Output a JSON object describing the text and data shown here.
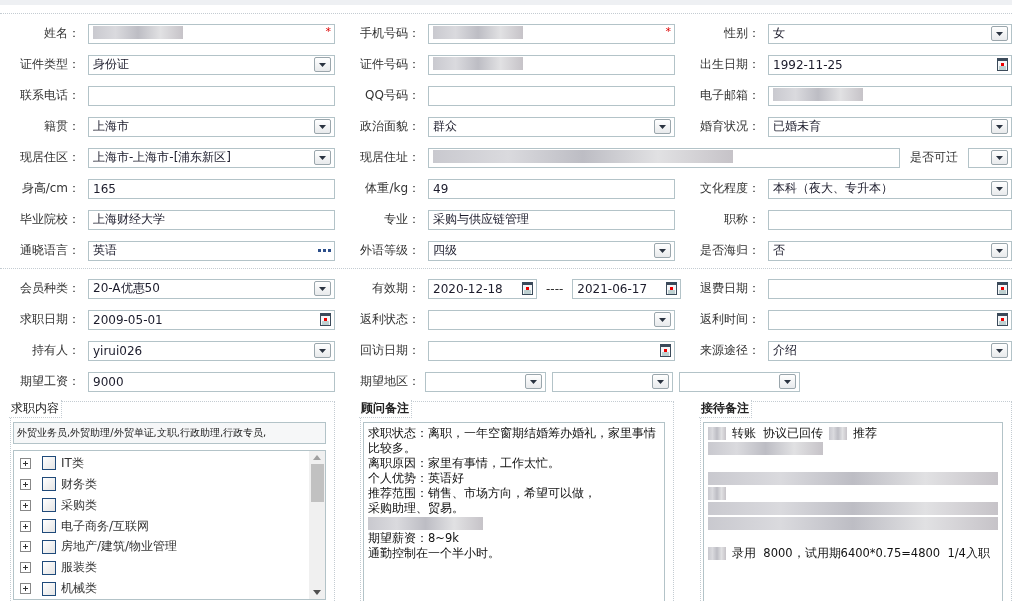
{
  "personal": [
    {
      "cells": [
        {
          "label": "姓名：",
          "kind": "text",
          "redacted": true,
          "required_mark": "*"
        },
        {
          "label": "手机号码：",
          "kind": "text",
          "redacted": true,
          "required_mark": "*"
        },
        {
          "label": "性别：",
          "kind": "select",
          "value": "女"
        }
      ]
    },
    {
      "cells": [
        {
          "label": "证件类型：",
          "kind": "select",
          "value": "身份证"
        },
        {
          "label": "证件号码：",
          "kind": "text",
          "redacted": true
        },
        {
          "label": "出生日期：",
          "kind": "date",
          "value": "1992-11-25"
        }
      ]
    },
    {
      "cells": [
        {
          "label": "联系电话：",
          "kind": "text"
        },
        {
          "label": "QQ号码：",
          "kind": "text"
        },
        {
          "label": "电子邮箱：",
          "kind": "text",
          "redacted": true
        }
      ]
    },
    {
      "cells": [
        {
          "label": "籍贯：",
          "kind": "select",
          "value": "上海市"
        },
        {
          "label": "政治面貌：",
          "kind": "select",
          "value": "群众"
        },
        {
          "label": "婚育状况：",
          "kind": "select",
          "value": "已婚未育"
        }
      ]
    },
    {
      "cells": [
        {
          "label": "现居住区：",
          "kind": "select",
          "value": "上海市-上海市-[浦东新区]"
        },
        {
          "label": "现居住址：",
          "kind": "wide_text",
          "redacted": true
        },
        {
          "label": "是否可迁",
          "kind": "short_select"
        }
      ]
    },
    {
      "cells": [
        {
          "label": "身高/cm：",
          "kind": "text",
          "value": "165"
        },
        {
          "label": "体重/kg：",
          "kind": "text",
          "value": "49"
        },
        {
          "label": "文化程度：",
          "kind": "select",
          "value": "本科（夜大、专升本）"
        }
      ]
    },
    {
      "cells": [
        {
          "label": "毕业院校：",
          "kind": "text",
          "value": "上海财经大学"
        },
        {
          "label": "专业：",
          "kind": "text",
          "value": "采购与供应链管理"
        },
        {
          "label": "职称：",
          "kind": "text"
        }
      ]
    },
    {
      "cells": [
        {
          "label": "通晓语言：",
          "kind": "picker",
          "value": "英语"
        },
        {
          "label": "外语等级：",
          "kind": "select",
          "value": "四级"
        },
        {
          "label": "是否海归：",
          "kind": "select",
          "value": "否"
        }
      ]
    }
  ],
  "membership": [
    {
      "cells": [
        {
          "label": "会员种类：",
          "kind": "select",
          "value": "20-A优惠50"
        },
        {
          "label": "有效期：",
          "kind": "daterange",
          "from": "2020-12-18",
          "separator": "----",
          "to": "2021-06-17"
        },
        {
          "label": "退费日期：",
          "kind": "date"
        }
      ]
    },
    {
      "cells": [
        {
          "label": "求职日期：",
          "kind": "date",
          "value": "2009-05-01"
        },
        {
          "label": "返利状态：",
          "kind": "select"
        },
        {
          "label": "返利时间：",
          "kind": "date"
        }
      ]
    },
    {
      "cells": [
        {
          "label": "持有人：",
          "kind": "select",
          "value": "yirui026"
        },
        {
          "label": "回访日期：",
          "kind": "date"
        },
        {
          "label": "来源途径：",
          "kind": "select",
          "value": "介绍"
        }
      ]
    },
    {
      "cells": [
        {
          "label": "期望工资：",
          "kind": "text",
          "value": "9000"
        },
        {
          "label": "期望地区：",
          "kind": "multi_select",
          "selects": [
            {
              "kind": "select"
            },
            {
              "kind": "select"
            },
            {
              "kind": "select"
            }
          ]
        }
      ]
    }
  ],
  "job": {
    "title": "求职内容",
    "summary": "外贸业务员,外贸助理/外贸单证,文职,行政助理,行政专员,",
    "tree": [
      {
        "label": "IT类",
        "checked": false,
        "expanded": false
      },
      {
        "label": "财务类",
        "checked": false,
        "expanded": false
      },
      {
        "label": "采购类",
        "checked": false,
        "expanded": false
      },
      {
        "label": "电子商务/互联网",
        "checked": false,
        "expanded": false
      },
      {
        "label": "房地产/建筑/物业管理",
        "checked": false,
        "expanded": false
      },
      {
        "label": "服装类",
        "checked": false,
        "expanded": false
      },
      {
        "label": "机械类",
        "checked": false,
        "expanded": false
      }
    ]
  },
  "notes": [
    {
      "title": "顾问备注",
      "lines": [
        [
          {
            "kind": "text",
            "text": "求职状态：离职，一年空窗期结婚筹办婚礼，家里事情比较多。"
          }
        ],
        [
          {
            "kind": "text",
            "text": "离职原因：家里有事情，工作太忙。"
          }
        ],
        [
          {
            "kind": "text",
            "text": "个人优势：英语好"
          }
        ],
        [
          {
            "kind": "text",
            "text": "推荐范围：销售、市场方向，希望可以做，"
          }
        ],
        [
          {
            "kind": "text",
            "text": "采购助理、贸易。"
          }
        ],
        [
          {
            "kind": "blur_short"
          }
        ],
        [
          {
            "kind": "text",
            "text": "期望薪资：8~9k"
          }
        ],
        [
          {
            "kind": "text",
            "text": "通勤控制在一个半小时。"
          }
        ]
      ]
    },
    {
      "title": "接待备注",
      "lines": [
        [
          {
            "kind": "blur_tiny"
          },
          {
            "kind": "text",
            "text": "转账  协议已回传"
          },
          {
            "kind": "blur_tiny"
          },
          {
            "kind": "text",
            "text": "推荐"
          }
        ],
        [
          {
            "kind": "blur_short"
          }
        ],
        [
          {
            "kind": "gap"
          }
        ],
        [
          {
            "kind": "blur_line"
          }
        ],
        [
          {
            "kind": "blur_tiny"
          }
        ],
        [
          {
            "kind": "blur_line"
          }
        ],
        [
          {
            "kind": "blur_line"
          }
        ],
        [
          {
            "kind": "gap"
          }
        ],
        [
          {
            "kind": "blur_tiny"
          },
          {
            "kind": "text",
            "text": "录用  8000，试用期6400*0.75=4800  1/4入职"
          }
        ]
      ]
    }
  ]
}
